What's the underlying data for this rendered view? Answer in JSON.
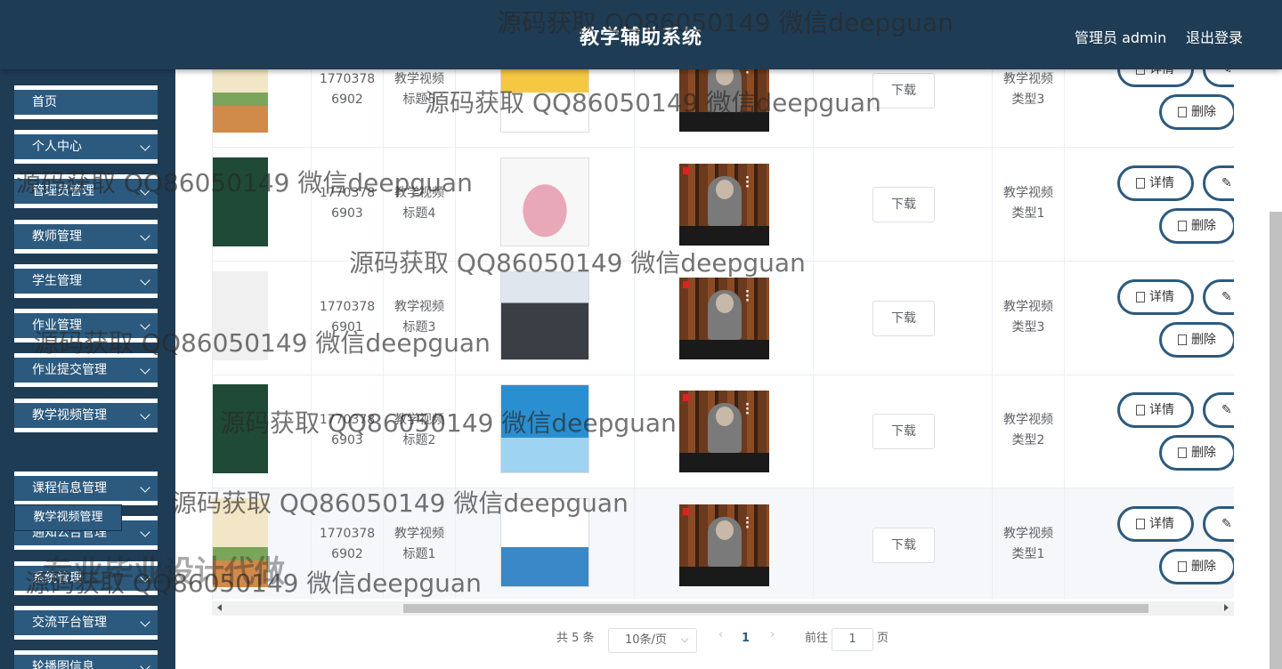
{
  "header": {
    "title": "教学辅助系统",
    "user": "管理员 admin",
    "logout": "退出登录"
  },
  "sidebar": {
    "items": [
      {
        "label": "首页",
        "chev": false
      },
      {
        "label": "个人中心",
        "chev": true
      },
      {
        "label": "管理员管理",
        "chev": true
      },
      {
        "label": "教师管理",
        "chev": true
      },
      {
        "label": "学生管理",
        "chev": true
      },
      {
        "label": "作业管理",
        "chev": true
      },
      {
        "label": "作业提交管理",
        "chev": true
      },
      {
        "label": "教学视频管理",
        "chev": true
      },
      {
        "label": "课程信息管理",
        "chev": true
      },
      {
        "label": "通知公告管理",
        "chev": true
      },
      {
        "label": "系统管理",
        "chev": true
      },
      {
        "label": "交流平台管理",
        "chev": true
      },
      {
        "label": "轮播图信息",
        "chev": true
      }
    ],
    "submenu": "教学视频管理"
  },
  "table": {
    "download_label": "下载",
    "detail_label": "详情",
    "delete_label": "删除",
    "rows": [
      {
        "account": "1770378\n6902",
        "title": "教学视频\n标题5",
        "type": "教学视频\n类型3"
      },
      {
        "account": "1770378\n6903",
        "title": "教学视频\n标题4",
        "type": "教学视频\n类型1"
      },
      {
        "account": "1770378\n6901",
        "title": "教学视频\n标题3",
        "type": "教学视频\n类型3"
      },
      {
        "account": "1770378\n6903",
        "title": "教学视频\n标题2",
        "type": "教学视频\n类型2"
      },
      {
        "account": "1770378\n6902",
        "title": "教学视频\n标题1",
        "type": "教学视频\n类型1"
      }
    ]
  },
  "pagination": {
    "total": "共 5 条",
    "page_size": "10条/页",
    "current_page": "1",
    "goto_prefix": "前往",
    "goto_value": "1",
    "goto_suffix": "页"
  },
  "watermark": {
    "text": "源码获取 QQ86050149 微信deepguan",
    "text2": "专业毕业设计代做"
  },
  "colors": {
    "header": "#1f3c55",
    "menu": "#2c5a7e",
    "accent": "#2c5a7e"
  }
}
